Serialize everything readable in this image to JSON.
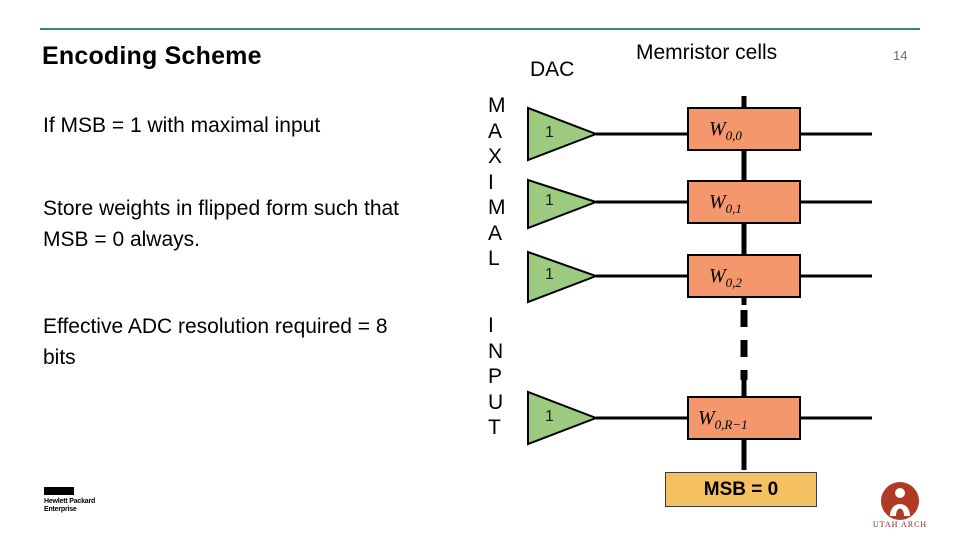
{
  "slide": {
    "title": "Encoding Scheme",
    "number": "14",
    "accent_color": "#2e8b80",
    "bullets": [
      "If MSB = 1 with maximal input",
      "Store weights in flipped form such that MSB = 0 always.",
      "Effective ADC resolution required = 8 bits"
    ]
  },
  "diagram": {
    "dac_label": "DAC",
    "memristor_label": "Memristor cells",
    "maximal_letters": "M\nA\nX\nI\nM\nA\nL",
    "input_letters": "I\nN\nP\nU\nT",
    "dac_values": [
      "1",
      "1",
      "1",
      "1"
    ],
    "dac_fill": "#9ccb80",
    "weight_labels": [
      {
        "w": "W",
        "sub": "0,0"
      },
      {
        "w": "W",
        "sub": "0,1"
      },
      {
        "w": "W",
        "sub": "0,2"
      },
      {
        "w": "W",
        "sub": "0,R−1"
      }
    ],
    "weight_fill": "#f4976c",
    "msb_note": "MSB = 0",
    "msb_fill": "#f5c05f"
  },
  "logos": {
    "hpe_line1": "Hewlett Packard",
    "hpe_line2": "Enterprise",
    "utah_text": "UTAH ARCH"
  }
}
